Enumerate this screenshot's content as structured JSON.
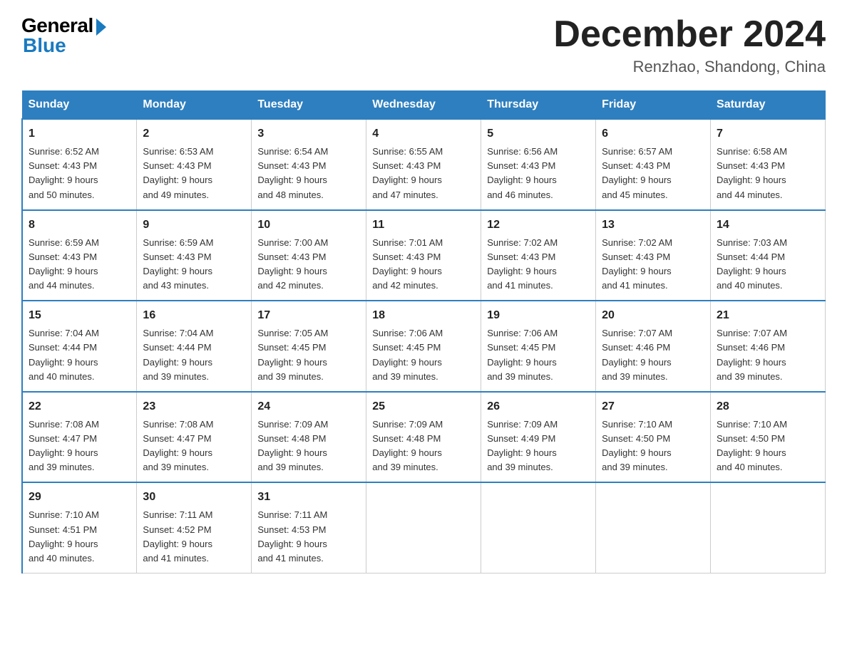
{
  "logo": {
    "general": "General",
    "blue": "Blue"
  },
  "title": "December 2024",
  "location": "Renzhao, Shandong, China",
  "weekdays": [
    "Sunday",
    "Monday",
    "Tuesday",
    "Wednesday",
    "Thursday",
    "Friday",
    "Saturday"
  ],
  "weeks": [
    [
      {
        "day": "1",
        "sunrise": "6:52 AM",
        "sunset": "4:43 PM",
        "daylight": "9 hours and 50 minutes."
      },
      {
        "day": "2",
        "sunrise": "6:53 AM",
        "sunset": "4:43 PM",
        "daylight": "9 hours and 49 minutes."
      },
      {
        "day": "3",
        "sunrise": "6:54 AM",
        "sunset": "4:43 PM",
        "daylight": "9 hours and 48 minutes."
      },
      {
        "day": "4",
        "sunrise": "6:55 AM",
        "sunset": "4:43 PM",
        "daylight": "9 hours and 47 minutes."
      },
      {
        "day": "5",
        "sunrise": "6:56 AM",
        "sunset": "4:43 PM",
        "daylight": "9 hours and 46 minutes."
      },
      {
        "day": "6",
        "sunrise": "6:57 AM",
        "sunset": "4:43 PM",
        "daylight": "9 hours and 45 minutes."
      },
      {
        "day": "7",
        "sunrise": "6:58 AM",
        "sunset": "4:43 PM",
        "daylight": "9 hours and 44 minutes."
      }
    ],
    [
      {
        "day": "8",
        "sunrise": "6:59 AM",
        "sunset": "4:43 PM",
        "daylight": "9 hours and 44 minutes."
      },
      {
        "day": "9",
        "sunrise": "6:59 AM",
        "sunset": "4:43 PM",
        "daylight": "9 hours and 43 minutes."
      },
      {
        "day": "10",
        "sunrise": "7:00 AM",
        "sunset": "4:43 PM",
        "daylight": "9 hours and 42 minutes."
      },
      {
        "day": "11",
        "sunrise": "7:01 AM",
        "sunset": "4:43 PM",
        "daylight": "9 hours and 42 minutes."
      },
      {
        "day": "12",
        "sunrise": "7:02 AM",
        "sunset": "4:43 PM",
        "daylight": "9 hours and 41 minutes."
      },
      {
        "day": "13",
        "sunrise": "7:02 AM",
        "sunset": "4:43 PM",
        "daylight": "9 hours and 41 minutes."
      },
      {
        "day": "14",
        "sunrise": "7:03 AM",
        "sunset": "4:44 PM",
        "daylight": "9 hours and 40 minutes."
      }
    ],
    [
      {
        "day": "15",
        "sunrise": "7:04 AM",
        "sunset": "4:44 PM",
        "daylight": "9 hours and 40 minutes."
      },
      {
        "day": "16",
        "sunrise": "7:04 AM",
        "sunset": "4:44 PM",
        "daylight": "9 hours and 39 minutes."
      },
      {
        "day": "17",
        "sunrise": "7:05 AM",
        "sunset": "4:45 PM",
        "daylight": "9 hours and 39 minutes."
      },
      {
        "day": "18",
        "sunrise": "7:06 AM",
        "sunset": "4:45 PM",
        "daylight": "9 hours and 39 minutes."
      },
      {
        "day": "19",
        "sunrise": "7:06 AM",
        "sunset": "4:45 PM",
        "daylight": "9 hours and 39 minutes."
      },
      {
        "day": "20",
        "sunrise": "7:07 AM",
        "sunset": "4:46 PM",
        "daylight": "9 hours and 39 minutes."
      },
      {
        "day": "21",
        "sunrise": "7:07 AM",
        "sunset": "4:46 PM",
        "daylight": "9 hours and 39 minutes."
      }
    ],
    [
      {
        "day": "22",
        "sunrise": "7:08 AM",
        "sunset": "4:47 PM",
        "daylight": "9 hours and 39 minutes."
      },
      {
        "day": "23",
        "sunrise": "7:08 AM",
        "sunset": "4:47 PM",
        "daylight": "9 hours and 39 minutes."
      },
      {
        "day": "24",
        "sunrise": "7:09 AM",
        "sunset": "4:48 PM",
        "daylight": "9 hours and 39 minutes."
      },
      {
        "day": "25",
        "sunrise": "7:09 AM",
        "sunset": "4:48 PM",
        "daylight": "9 hours and 39 minutes."
      },
      {
        "day": "26",
        "sunrise": "7:09 AM",
        "sunset": "4:49 PM",
        "daylight": "9 hours and 39 minutes."
      },
      {
        "day": "27",
        "sunrise": "7:10 AM",
        "sunset": "4:50 PM",
        "daylight": "9 hours and 39 minutes."
      },
      {
        "day": "28",
        "sunrise": "7:10 AM",
        "sunset": "4:50 PM",
        "daylight": "9 hours and 40 minutes."
      }
    ],
    [
      {
        "day": "29",
        "sunrise": "7:10 AM",
        "sunset": "4:51 PM",
        "daylight": "9 hours and 40 minutes."
      },
      {
        "day": "30",
        "sunrise": "7:11 AM",
        "sunset": "4:52 PM",
        "daylight": "9 hours and 41 minutes."
      },
      {
        "day": "31",
        "sunrise": "7:11 AM",
        "sunset": "4:53 PM",
        "daylight": "9 hours and 41 minutes."
      },
      null,
      null,
      null,
      null
    ]
  ]
}
